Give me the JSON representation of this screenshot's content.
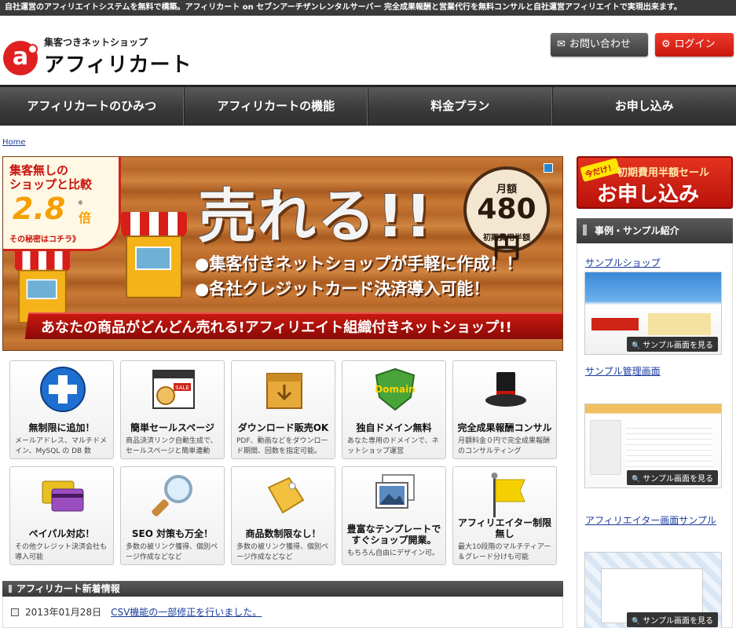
{
  "topbar": {
    "text": "自社運営のアフィリエイトシステムを無料で構築。アフィリカート on セブンアーチザンレンタルサーバー 完全成果報酬と営業代行を無料コンサルと自社運営アフィリエイトで実現出来ます。"
  },
  "header": {
    "logo_mark": "a",
    "logo_tagline": "集客つきネットショップ",
    "logo_name": "アフィリカート",
    "contact_label": "お問い合わせ",
    "login_label": "ログイン"
  },
  "nav": {
    "items": [
      {
        "label": "アフィリカートのひみつ"
      },
      {
        "label": "アフィリカートの機能"
      },
      {
        "label": "料金プラン"
      },
      {
        "label": "お申し込み"
      }
    ]
  },
  "breadcrumb": {
    "home": "Home"
  },
  "banner": {
    "side_line1": "集客無しの",
    "side_line2": "ショップと比較",
    "side_number": "2.8",
    "side_star": "※",
    "side_unit": "倍",
    "side_secret": "その秘密はコチラ》",
    "headline": "売れる!!",
    "price_label": "月額",
    "price_value": "480円",
    "price_note": "初期費用半額",
    "feature1": "●集客付きネットショップが手軽に作成！！",
    "feature2": "●各社クレジットカード決済導入可能！",
    "ribbon": "あなたの商品がどんどん売れる!アフィリエイト組織付きネットショップ!!"
  },
  "features": [
    {
      "title": "無制限に追加！",
      "desc": "メールアドレス、マルチドメイン、MySQL の DB 数"
    },
    {
      "title": "簡単セールスページ",
      "desc": "商品決済リンク自動生成で、セールスページと簡単連動"
    },
    {
      "title": "ダウンロード販売OK",
      "desc": "PDF、動画などをダウンロード期間、回数を指定可能。"
    },
    {
      "title": "独自ドメイン無料",
      "desc": "あなた専用のドメインで、ネットショップ運営"
    },
    {
      "title": "完全成果報酬コンサル",
      "desc": "月額料金０円で完全成果報酬のコンサルティング"
    },
    {
      "title": "ペイパル対応！",
      "desc": "その他クレジット決済会社も導入可能"
    },
    {
      "title": "SEO 対策も万全！",
      "desc": "多数の被リンク獲得、個別ページ作成などなど"
    },
    {
      "title": "商品数制限なし！",
      "desc": "多数の被リンク獲得、個別ページ作成などなど"
    },
    {
      "title": "豊富なテンプレートですぐショップ開業。",
      "desc": "もちろん自由にデザイン可。"
    },
    {
      "title": "アフィリエイター制限無し",
      "desc": "最大10段階のマルチティアー＆グレード分けも可能"
    }
  ],
  "domain_badge": "Domain",
  "sale_badge": "SALE",
  "news": {
    "heading": "アフィリカート新着情報",
    "items": [
      {
        "date": "2013年01月28日",
        "title": "CSV機能の一部修正を行いました。"
      }
    ]
  },
  "sidebar": {
    "cta_now": "今だけ！",
    "cta_sub": "初期費用半額セール",
    "cta_main": "お申し込み",
    "section_title": "事例・サンプル紹介",
    "links": [
      {
        "label": "サンプルショップ"
      },
      {
        "label": "サンプル管理画面"
      },
      {
        "label": "アフィリエイター画面サンプル"
      }
    ],
    "thumb_btn": "サンプル画面を見る"
  },
  "colors": {
    "accent_red": "#d02418",
    "dark_nav": "#3b3b3b",
    "link_blue": "#1a3c9c",
    "banner_orange": "#c97a36"
  },
  "icons": {
    "contact": "mail-icon",
    "login": "gear-icon",
    "news_bullet": "square-bullet-icon",
    "thumb": "magnifier-icon"
  }
}
